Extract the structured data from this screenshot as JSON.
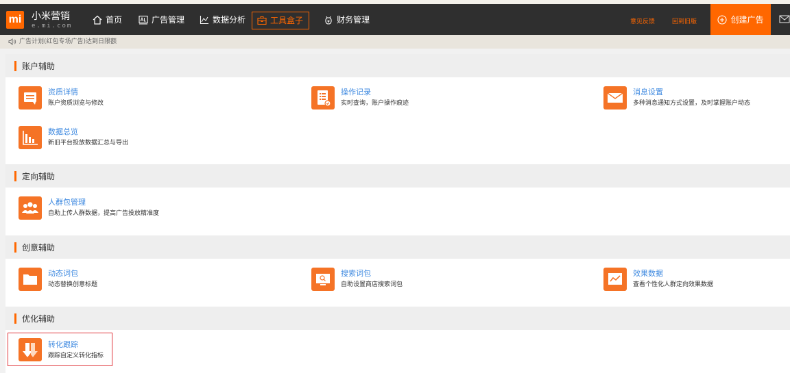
{
  "header": {
    "logo_mark": "mi",
    "logo_title": "小米营销",
    "logo_sub": "e.mi.com",
    "nav": [
      {
        "label": "首页",
        "icon": "home-icon"
      },
      {
        "label": "广告管理",
        "icon": "ad-icon"
      },
      {
        "label": "数据分析",
        "icon": "chart-icon"
      },
      {
        "label": "工具盒子",
        "icon": "toolbox-icon",
        "active": true
      },
      {
        "label": "财务管理",
        "icon": "finance-icon"
      }
    ],
    "feedback": "意见反馈",
    "old_version": "回到旧版",
    "create_ad": "创建广告"
  },
  "notice": {
    "text": "广告计划(红包专场广告)达到日限额"
  },
  "sections": [
    {
      "title": "账户辅助",
      "tools": [
        {
          "name": "资质详情",
          "desc": "账户资质浏览与修改",
          "icon": "license-icon"
        },
        {
          "name": "操作记录",
          "desc": "实时查询，账户操作痕迹",
          "icon": "record-icon"
        },
        {
          "name": "消息设置",
          "desc": "多种消息通知方式设置，及时掌握账户动态",
          "icon": "mail-icon"
        },
        {
          "name": "数据总览",
          "desc": "新旧平台投放数据汇总与导出",
          "icon": "bar-chart-icon"
        }
      ]
    },
    {
      "title": "定向辅助",
      "tools": [
        {
          "name": "人群包管理",
          "desc": "自助上传人群数据，提高广告投放精准度",
          "icon": "people-icon"
        }
      ]
    },
    {
      "title": "创意辅助",
      "tools": [
        {
          "name": "动态词包",
          "desc": "动态替换创意标题",
          "icon": "folder-icon"
        },
        {
          "name": "搜索词包",
          "desc": "自助设置商店搜索词包",
          "icon": "search-screen-icon"
        },
        {
          "name": "效果数据",
          "desc": "查看个性化人群定向效果数据",
          "icon": "trend-icon"
        }
      ]
    },
    {
      "title": "优化辅助",
      "tools": [
        {
          "name": "转化跟踪",
          "desc": "跟踪自定义转化指标",
          "icon": "conversion-icon"
        }
      ]
    }
  ],
  "colors": {
    "brand_orange": "#ff6700",
    "link_blue": "#3f8ae0",
    "nav_bg": "#2f2f2f"
  }
}
